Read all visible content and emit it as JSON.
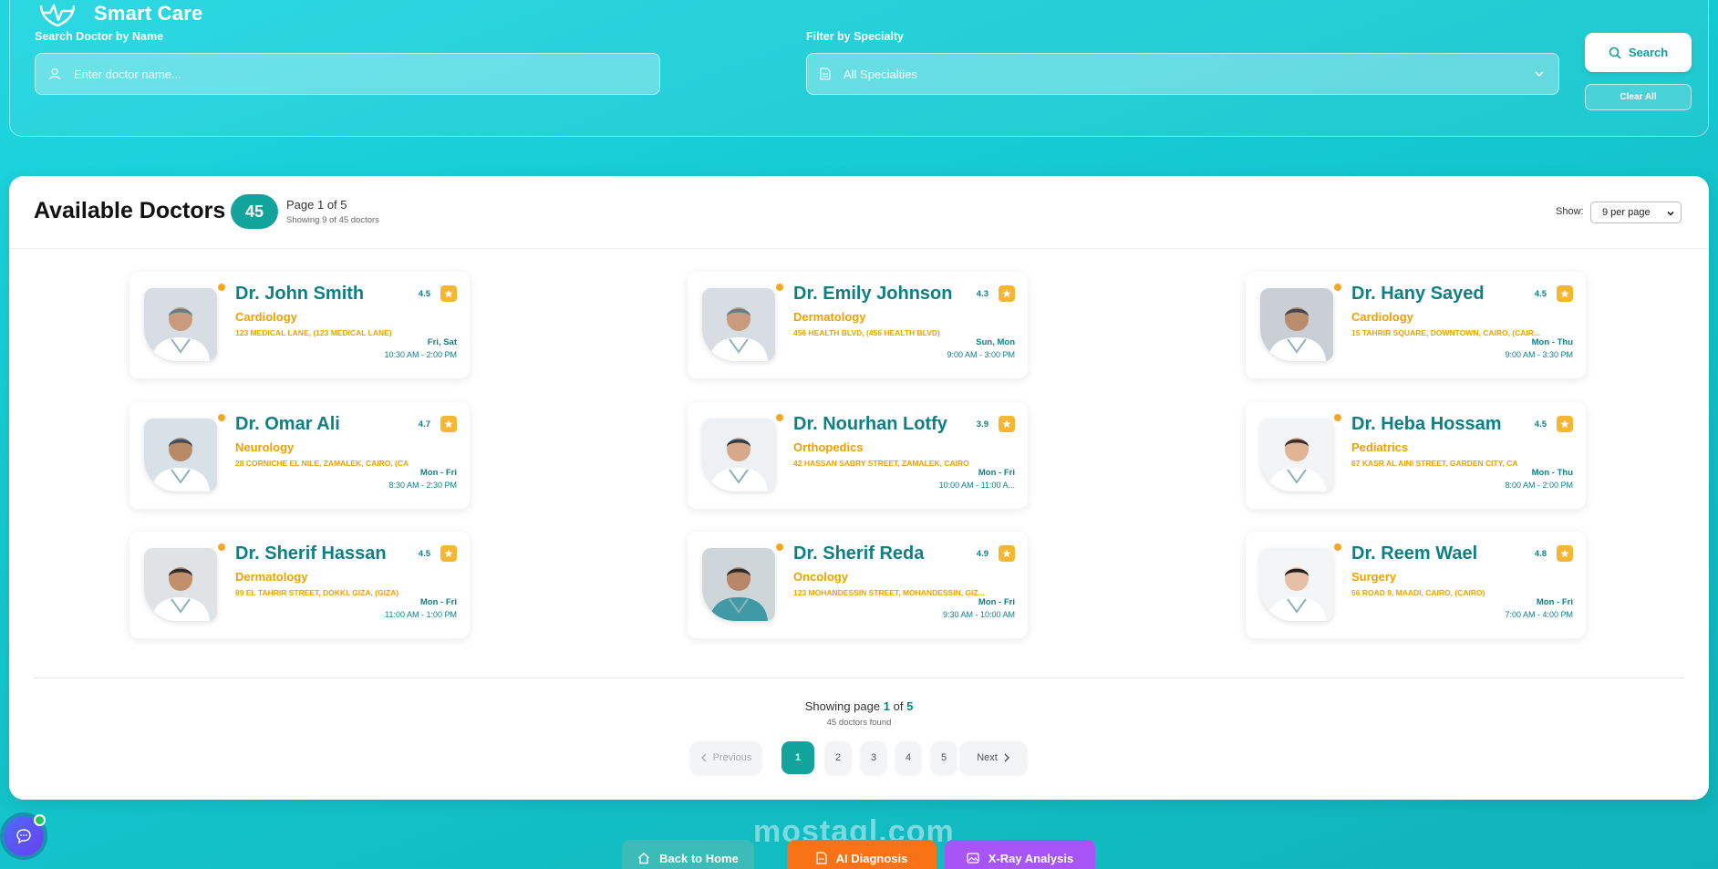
{
  "brand": {
    "name": "Smart Care"
  },
  "search": {
    "name_label": "Search Doctor by Name",
    "name_placeholder": "Enter doctor name...",
    "specialty_label": "Filter by Specialty",
    "specialty_value": "All Specialties",
    "search_button": "Search",
    "clear_button": "Clear All"
  },
  "main": {
    "title": "Available Doctors",
    "count": "45",
    "page_info": "Page 1 of 5",
    "page_sub": "Showing 9 of 45 doctors",
    "show_label": "Show:",
    "per_page": "9 per page"
  },
  "doctors": [
    {
      "name": "Dr. John Smith",
      "specialty": "Cardiology",
      "address": "123 MEDICAL LANE, (123 MEDICAL LANE)",
      "rating": "4.5",
      "days": "Fri, Sat",
      "hours": "10:30 AM - 2:00 PM"
    },
    {
      "name": "Dr. Emily Johnson",
      "specialty": "Dermatology",
      "address": "456 HEALTH BLVD, (456 HEALTH BLVD)",
      "rating": "4.3",
      "days": "Sun, Mon",
      "hours": "9:00 AM - 3:00 PM"
    },
    {
      "name": "Dr. Hany Sayed",
      "specialty": "Cardiology",
      "address": "15 TAHRIR SQUARE, DOWNTOWN, CAIRO, (CAIR...",
      "rating": "4.5",
      "days": "Mon - Thu",
      "hours": "9:00 AM - 3:30 PM"
    },
    {
      "name": "Dr. Omar Ali",
      "specialty": "Neurology",
      "address": "28 CORNICHE EL NILE, ZAMALEK, CAIRO, (CA",
      "rating": "4.7",
      "days": "Mon - Fri",
      "hours": "8:30 AM - 2:30 PM"
    },
    {
      "name": "Dr. Nourhan Lotfy",
      "specialty": "Orthopedics",
      "address": "42 HASSAN SABRY STREET, ZAMALEK, CAIRO",
      "rating": "3.9",
      "days": "Mon - Fri",
      "hours": "10:00 AM - 11:00 A..."
    },
    {
      "name": "Dr. Heba Hossam",
      "specialty": "Pediatrics",
      "address": "67 KASR AL AINI STREET, GARDEN CITY, CA",
      "rating": "4.5",
      "days": "Mon - Thu",
      "hours": "8:00 AM - 2:00 PM"
    },
    {
      "name": "Dr. Sherif Hassan",
      "specialty": "Dermatology",
      "address": "89 EL TAHRIR STREET, DOKKI, GIZA, (GIZA)",
      "rating": "4.5",
      "days": "Mon - Fri",
      "hours": "11:00 AM - 1:00 PM"
    },
    {
      "name": "Dr. Sherif Reda",
      "specialty": "Oncology",
      "address": "123 MOHANDESSIN STREET, MOHANDESSIN, GIZ...",
      "rating": "4.9",
      "days": "Mon - Fri",
      "hours": "9:30 AM - 10:00 AM"
    },
    {
      "name": "Dr. Reem Wael",
      "specialty": "Surgery",
      "address": "56 ROAD 9, MAADI, CAIRO, (CAIRO)",
      "rating": "4.8",
      "days": "Mon - Fri",
      "hours": "7:00 AM - 4:00 PM"
    }
  ],
  "pagination": {
    "showing_prefix": "Showing page",
    "current": "1",
    "of": "of",
    "total": "5",
    "found": "45 doctors found",
    "previous": "Previous",
    "next": "Next",
    "pages": [
      "1",
      "2",
      "3",
      "4",
      "5"
    ]
  },
  "bottom": {
    "home": "Back to Home",
    "ai": "AI Diagnosis",
    "xray": "X-Ray Analysis",
    "home_color": "#3cbcb8",
    "ai_color": "#f97316",
    "xray_color": "#a855f7"
  },
  "watermark": "mostaql.com",
  "colors": {
    "accent": "#13a39d",
    "name": "#0f7f86",
    "specialty": "#f0a000",
    "star": "#f5b731"
  }
}
